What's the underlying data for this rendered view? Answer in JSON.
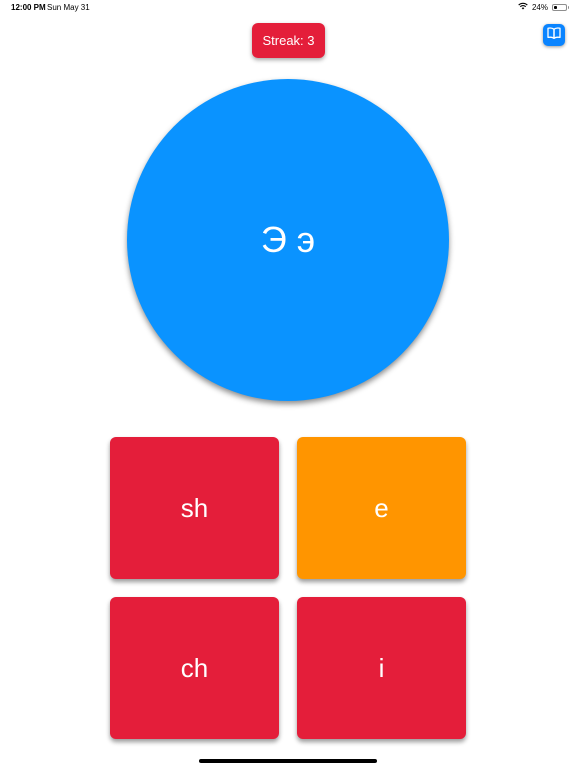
{
  "status_bar": {
    "time": "12:00 PM",
    "date": "Sun May 31",
    "battery_text": "24%",
    "battery_level": 0.24
  },
  "streak": {
    "label": "Streak: 3"
  },
  "letter": {
    "text": "Э э"
  },
  "answers": [
    {
      "label": "sh",
      "color": "#e41e3a"
    },
    {
      "label": "e",
      "color": "#ff9500"
    },
    {
      "label": "ch",
      "color": "#e41e3a"
    },
    {
      "label": "i",
      "color": "#e41e3a"
    }
  ],
  "icons": {
    "book_button": "book-icon",
    "wifi": "wifi-icon",
    "battery": "battery-icon"
  },
  "colors": {
    "accent_red": "#e41e3a",
    "accent_orange": "#ff9500",
    "circle_blue": "#0a93ff",
    "book_blue": "#0a84ff"
  }
}
